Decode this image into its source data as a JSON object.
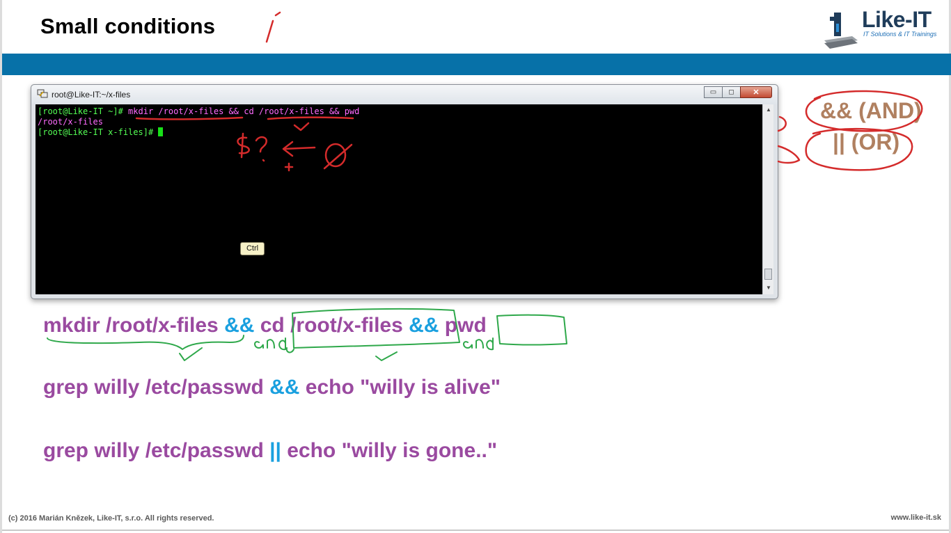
{
  "slide": {
    "title": "Small conditions",
    "logo_name": "Like-IT",
    "logo_tagline": "IT Solutions & IT Trainings",
    "footer_copyright": "(c) 2016 Marián Knězek, Like-IT, s.r.o. All rights reserved.",
    "footer_url": "www.like-it.sk",
    "band_color": "#0771a8"
  },
  "terminal": {
    "window_title": "root@Like-IT:~/x-files",
    "buttons": {
      "minimize": "▭",
      "maximize": "◻",
      "close": "✕"
    },
    "lines": [
      {
        "prompt": "[root@Like-IT ~]# ",
        "text": "mkdir /root/x-files && cd /root/x-files && pwd"
      },
      {
        "prompt": "",
        "text": "/root/x-files"
      },
      {
        "prompt": "[root@Like-IT x-files]# ",
        "text": ""
      }
    ],
    "tooltip": "Ctrl"
  },
  "examples": {
    "line1": {
      "part1": "mkdir /root/x-files ",
      "op1": "&&",
      "part2": " cd /root/x-files ",
      "op2": "&&",
      "part3": " pwd"
    },
    "line2": {
      "part1": "grep willy /etc/passwd ",
      "op": "&&",
      "part2": " echo \"willy is alive\""
    },
    "line3": {
      "part1": "grep willy /etc/passwd ",
      "op": "||",
      "part2": " echo \"willy is gone..\""
    }
  },
  "legend": {
    "and_label": "&& (AND)",
    "or_label": "|| (OR)"
  },
  "annotations": {
    "and_word": "and",
    "ink_colors": {
      "red": "#d42b2b",
      "green": "#2ea84a"
    }
  }
}
